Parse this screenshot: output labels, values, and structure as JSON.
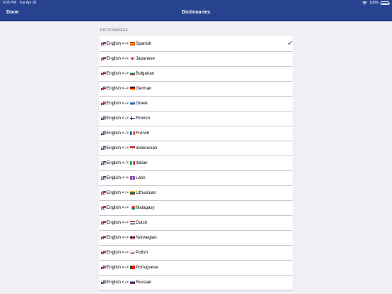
{
  "status_bar": {
    "time": "6:55 PM",
    "date": "Tue Apr 30",
    "battery": "100%"
  },
  "nav": {
    "done_label": "Done",
    "title": "Dictionaries"
  },
  "section_header": "DICTIONARIES:",
  "source_flag": "gb",
  "dictionaries": [
    {
      "from": "English",
      "arrow": "<->",
      "to": "Spanish",
      "flag": "es",
      "selected": true
    },
    {
      "from": "English",
      "arrow": "<->",
      "to": "Japanese",
      "flag": "jp",
      "selected": false
    },
    {
      "from": "English",
      "arrow": "<->",
      "to": "Bulgarian",
      "flag": "bg",
      "selected": false
    },
    {
      "from": "English",
      "arrow": "<->",
      "to": "German",
      "flag": "de",
      "selected": false
    },
    {
      "from": "English",
      "arrow": "<->",
      "to": "Greek",
      "flag": "gr",
      "selected": false
    },
    {
      "from": "English",
      "arrow": "<->",
      "to": "Finnish",
      "flag": "fi",
      "selected": false
    },
    {
      "from": "English",
      "arrow": "<->",
      "to": "French",
      "flag": "fr",
      "selected": false
    },
    {
      "from": "English",
      "arrow": "<->",
      "to": "Indonesian",
      "flag": "id",
      "selected": false
    },
    {
      "from": "English",
      "arrow": "<->",
      "to": "Italian",
      "flag": "it",
      "selected": false
    },
    {
      "from": "English",
      "arrow": "<->",
      "to": "Latin",
      "flag": "la",
      "selected": false
    },
    {
      "from": "English",
      "arrow": "<->",
      "to": "Lithuanian",
      "flag": "lt",
      "selected": false
    },
    {
      "from": "English",
      "arrow": "<->",
      "to": "Malagasy",
      "flag": "mg",
      "selected": false
    },
    {
      "from": "English",
      "arrow": "<->",
      "to": "Dutch",
      "flag": "nl",
      "selected": false
    },
    {
      "from": "English",
      "arrow": "<->",
      "to": "Norwegian",
      "flag": "no",
      "selected": false
    },
    {
      "from": "English",
      "arrow": "<->",
      "to": "Polish",
      "flag": "pl",
      "selected": false
    },
    {
      "from": "English",
      "arrow": "<->",
      "to": "Portuguese",
      "flag": "pt",
      "selected": false
    },
    {
      "from": "English",
      "arrow": "<->",
      "to": "Russian",
      "flag": "ru",
      "selected": false
    }
  ],
  "colors": {
    "nav_background": "#27428f",
    "nav_text": "#ffffff",
    "page_background": "#f0eff4",
    "section_header_text": "#6d6d72",
    "checkmark": "#27428f",
    "separator": "#c8c7cc"
  }
}
